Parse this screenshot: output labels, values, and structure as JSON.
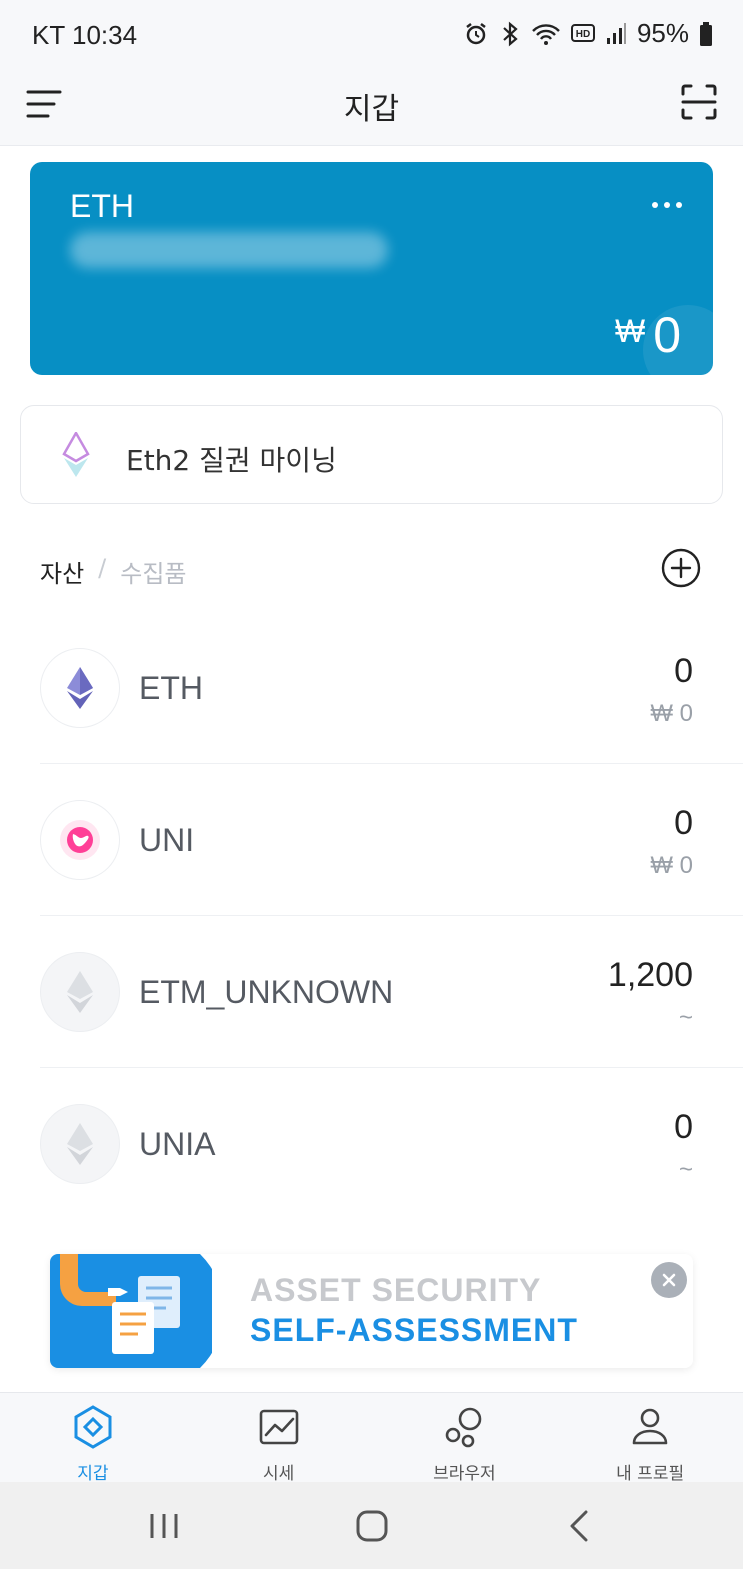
{
  "status_bar": {
    "carrier_time": "KT 10:34",
    "battery": "95%"
  },
  "header": {
    "title": "지갑"
  },
  "wallet_card": {
    "coin": "ETH",
    "currency_symbol": "₩",
    "balance": "0"
  },
  "staking": {
    "label": "Eth2 질권 마이닝"
  },
  "tabs": {
    "assets": "자산",
    "separator": "/",
    "collectibles": "수집품"
  },
  "assets": [
    {
      "name": "ETH",
      "amount": "0",
      "fiat": "₩ 0"
    },
    {
      "name": "UNI",
      "amount": "0",
      "fiat": "₩ 0"
    },
    {
      "name": "ETM_UNKNOWN",
      "amount": "1,200",
      "fiat": "~"
    },
    {
      "name": "UNIA",
      "amount": "0",
      "fiat": "~"
    }
  ],
  "promo": {
    "line1": "ASSET SECURITY",
    "line2": "SELF-ASSESSMENT"
  },
  "bottom_nav": [
    {
      "label": "지갑",
      "icon": "wallet-icon",
      "active": true
    },
    {
      "label": "시세",
      "icon": "market-chart-icon",
      "active": false
    },
    {
      "label": "브라우저",
      "icon": "browser-icon",
      "active": false
    },
    {
      "label": "내 프로필",
      "icon": "profile-icon",
      "active": false
    }
  ],
  "colors": {
    "card_bg": "#078fc4",
    "accent": "#1a8fe3",
    "promo_blue": "#1a8fe3"
  }
}
